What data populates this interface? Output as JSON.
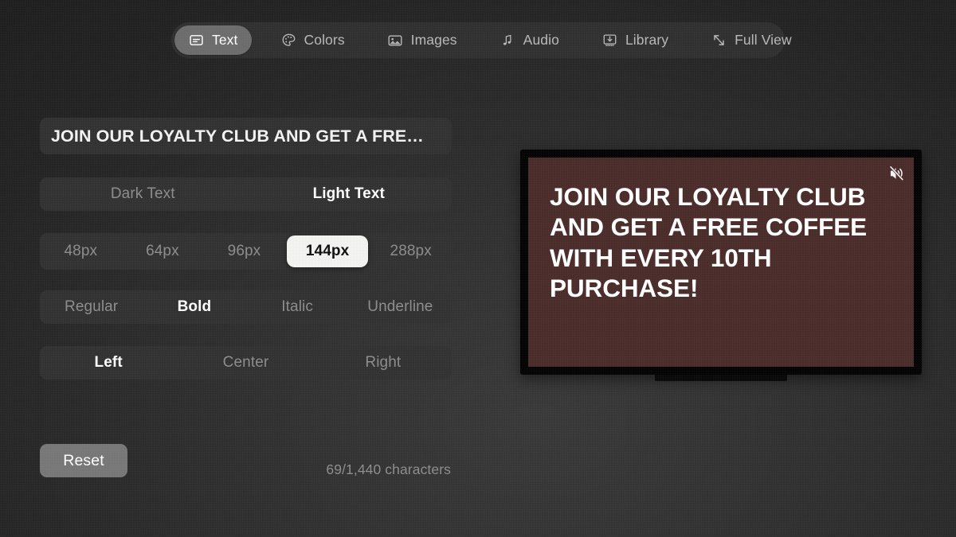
{
  "tabs": [
    {
      "id": "text",
      "label": "Text",
      "icon": "text-box-icon",
      "selected": true
    },
    {
      "id": "colors",
      "label": "Colors",
      "icon": "palette-icon",
      "selected": false
    },
    {
      "id": "images",
      "label": "Images",
      "icon": "photo-icon",
      "selected": false
    },
    {
      "id": "audio",
      "label": "Audio",
      "icon": "music-note-icon",
      "selected": false
    },
    {
      "id": "library",
      "label": "Library",
      "icon": "tray-down-icon",
      "selected": false
    },
    {
      "id": "full_view",
      "label": "Full View",
      "icon": "expand-icon",
      "selected": false
    }
  ],
  "editor": {
    "message_field": {
      "value": "JOIN OUR LOYALTY CLUB AND GET A FRE…",
      "placeholder": "Enter your message"
    },
    "theme_row": {
      "options": [
        "Dark Text",
        "Light Text"
      ],
      "selected": "Light Text"
    },
    "size_row": {
      "options": [
        "48px",
        "64px",
        "96px",
        "144px",
        "288px"
      ],
      "selected": "144px"
    },
    "style_row": {
      "options": [
        "Regular",
        "Bold",
        "Italic",
        "Underline"
      ],
      "selected": "Bold"
    },
    "align_row": {
      "options": [
        "Left",
        "Center",
        "Right"
      ],
      "selected": "Left"
    },
    "reset_label": "Reset",
    "counter": "69/1,440 characters"
  },
  "preview": {
    "message": "JOIN OUR LOYALTY CLUB AND GET A FREE COFFEE WITH EVERY 10TH PURCHASE!",
    "screen_color": "#4b2e2b",
    "text_color": "#ffffff",
    "bezel_color": "#050505",
    "mute_icon": "speaker-muted-icon",
    "muted": true
  },
  "colors": {
    "background": "#2c2c2c",
    "surface": "#333333",
    "tabbar": "#343434",
    "tab_selected": "#6d6d6d",
    "focus_pill": "#f2f2f0",
    "reset_button": "#787878",
    "text_primary": "#ffffff",
    "text_muted": "#8d8d8d"
  }
}
